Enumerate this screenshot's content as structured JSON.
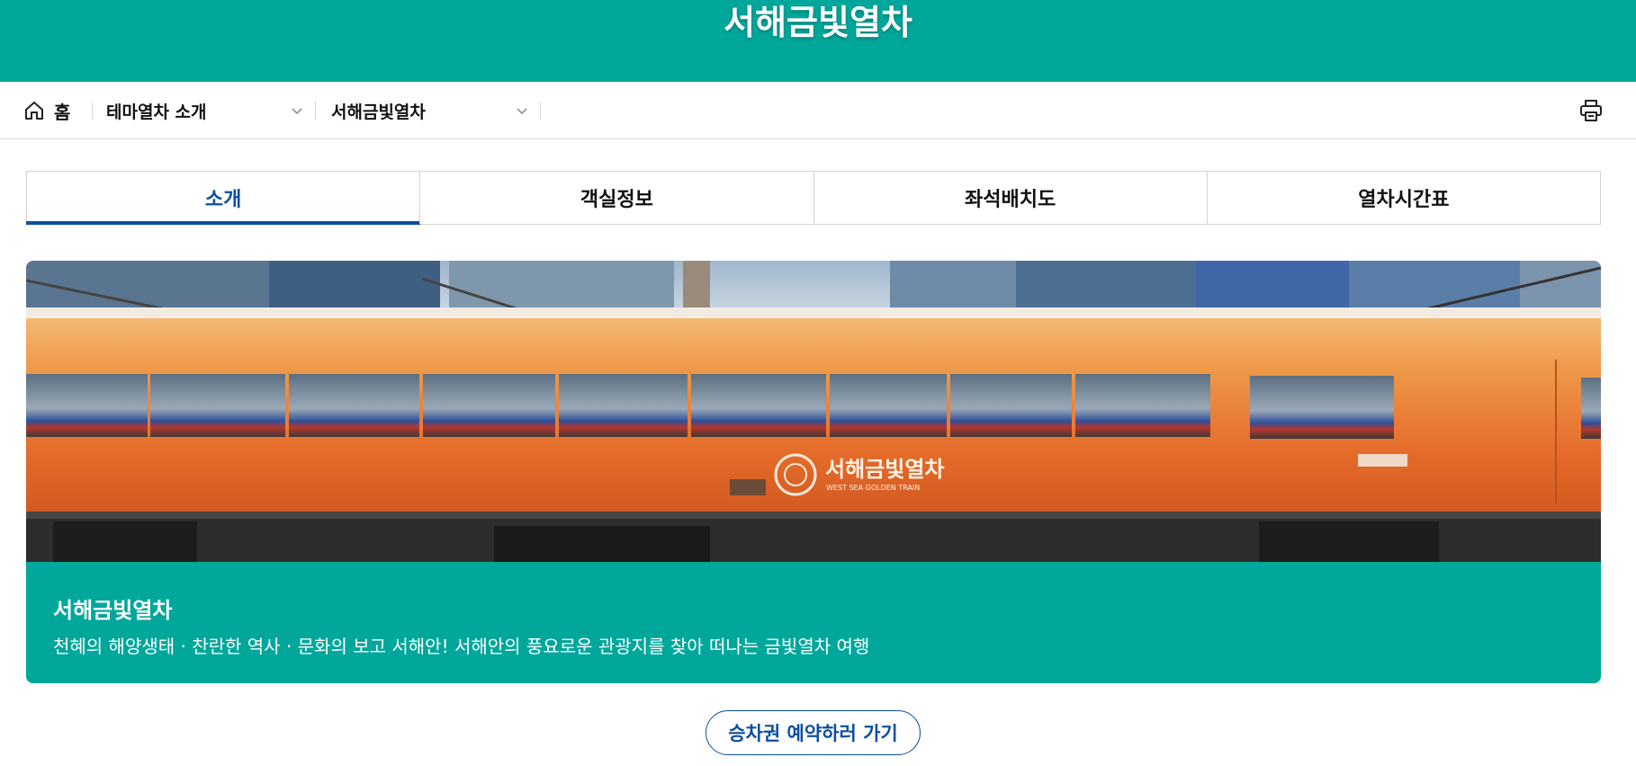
{
  "header": {
    "title": "서해금빛열차",
    "band_color": "#02a79b"
  },
  "breadcrumb": {
    "home_label": "홈",
    "level1": "테마열차 소개",
    "level2": "서해금빛열차",
    "home_icon": "home-icon",
    "chevron_icon": "chevron-down-icon",
    "print_icon": "print-icon"
  },
  "tabs": [
    {
      "label": "소개",
      "active": true
    },
    {
      "label": "객실정보",
      "active": false
    },
    {
      "label": "좌석배치도",
      "active": false
    },
    {
      "label": "열차시간표",
      "active": false
    }
  ],
  "hero": {
    "title": "서해금빛열차",
    "description": "천혜의 해양생태 · 찬란한 역사 · 문화의 보고 서해안! 서해안의 풍요로운 관광지를 찾아 떠나는 금빛열차 여행",
    "train_logo_text": "서해금빛열차",
    "train_logo_subtext": "WEST SEA GOLDEN TRAIN"
  },
  "actions": {
    "reserve_label": "승차권 예약하러 가기"
  },
  "colors": {
    "accent_blue": "#0b4fa0",
    "teal": "#02a79b",
    "train_orange": "#e8702a"
  }
}
